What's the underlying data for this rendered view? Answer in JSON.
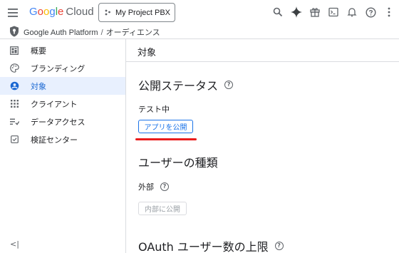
{
  "header": {
    "logo_google": "Google",
    "logo_cloud": "Cloud",
    "project_label": "My Project PBX",
    "icons": [
      "search-icon",
      "gemini-sparkle-icon",
      "gift-icon",
      "cloud-shell-icon",
      "notifications-icon",
      "help-icon",
      "more-vert-icon"
    ]
  },
  "breadcrumb": {
    "root": "Google Auth Platform",
    "separator": "/",
    "current": "オーディエンス"
  },
  "sidebar": {
    "items": [
      {
        "label": "概要",
        "icon": "dashboard-icon"
      },
      {
        "label": "ブランディング",
        "icon": "palette-icon"
      },
      {
        "label": "対象",
        "icon": "audience-icon"
      },
      {
        "label": "クライアント",
        "icon": "apps-grid-icon"
      },
      {
        "label": "データアクセス",
        "icon": "data-access-icon"
      },
      {
        "label": "検証センター",
        "icon": "verification-icon"
      }
    ],
    "collapse_glyph": "<|"
  },
  "main": {
    "page_title": "対象",
    "publishing_status": {
      "title": "公開ステータス",
      "status": "テスト中",
      "publish_button": "アプリを公開"
    },
    "user_type": {
      "title": "ユーザーの種類",
      "value": "外部",
      "internal_button": "内部に公開"
    },
    "oauth_limit": {
      "title": "OAuth ユーザー数の上限"
    },
    "help_glyph": "?"
  },
  "colors": {
    "accent": "#1a73e8",
    "active_bg": "#e8f0fe",
    "highlight": "#ea1c1c"
  }
}
